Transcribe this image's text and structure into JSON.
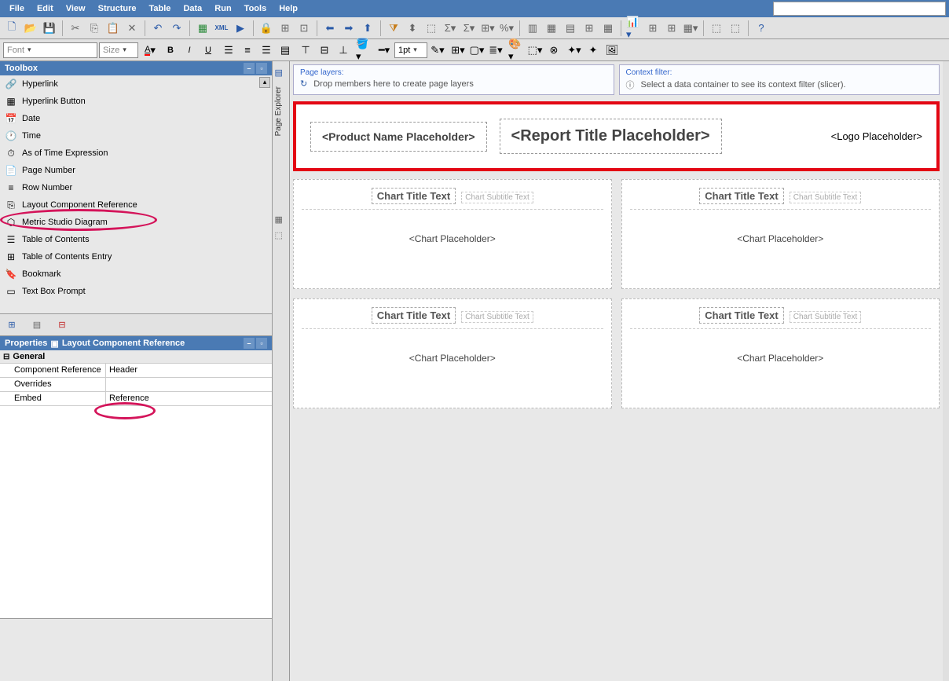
{
  "menu": {
    "file": "File",
    "edit": "Edit",
    "view": "View",
    "structure": "Structure",
    "table": "Table",
    "data": "Data",
    "run": "Run",
    "tools": "Tools",
    "help": "Help"
  },
  "toolbar2": {
    "font_label": "Font",
    "size_label": "Size",
    "linewidth": "1pt"
  },
  "toolbox": {
    "title": "Toolbox",
    "items": [
      {
        "icon": "🔗",
        "label": "Hyperlink"
      },
      {
        "icon": "▦",
        "label": "Hyperlink Button"
      },
      {
        "icon": "📅",
        "label": "Date"
      },
      {
        "icon": "🕐",
        "label": "Time"
      },
      {
        "icon": "⏱",
        "label": "As of Time Expression"
      },
      {
        "icon": "📄",
        "label": "Page Number"
      },
      {
        "icon": "≡",
        "label": "Row Number"
      },
      {
        "icon": "⎘",
        "label": "Layout Component Reference"
      },
      {
        "icon": "⬡",
        "label": "Metric Studio Diagram"
      },
      {
        "icon": "☰",
        "label": "Table of Contents"
      },
      {
        "icon": "⊞",
        "label": "Table of Contents Entry"
      },
      {
        "icon": "🔖",
        "label": "Bookmark"
      },
      {
        "icon": "▭",
        "label": "Text Box Prompt"
      }
    ]
  },
  "properties": {
    "title": "Properties",
    "subtitle": "Layout Component Reference",
    "group": "General",
    "rows": [
      {
        "label": "Component Reference",
        "value": "Header"
      },
      {
        "label": "Overrides",
        "value": ""
      },
      {
        "label": "Embed",
        "value": "Reference"
      }
    ]
  },
  "explorer": {
    "label": "Page Explorer"
  },
  "dropzones": {
    "page_layers_label": "Page layers:",
    "page_layers_text": "Drop members here to create page layers",
    "context_label": "Context filter:",
    "context_text": "Select a data container to see its context filter (slicer)."
  },
  "report": {
    "product_ph": "<Product Name Placeholder>",
    "title_ph": "<Report Title Placeholder>",
    "logo_ph": "<Logo Placeholder>",
    "chart_title": "Chart Title Text",
    "chart_subtitle": "Chart Subtitle Text",
    "chart_ph": "<Chart Placeholder>"
  }
}
